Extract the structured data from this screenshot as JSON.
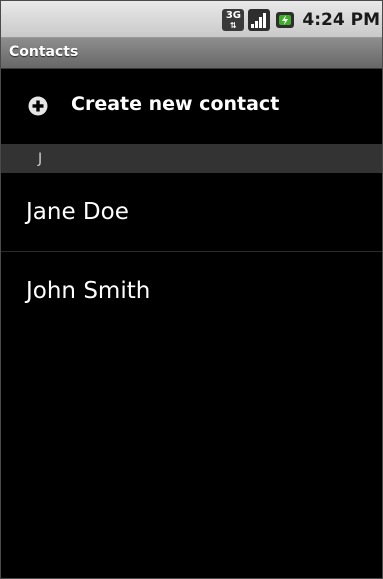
{
  "status_bar": {
    "network_label": "3G",
    "time": "4:24 PM",
    "icons": [
      "3g-data-icon",
      "signal-strength-icon",
      "battery-charging-icon"
    ],
    "colors": {
      "battery": "#3fae2a"
    }
  },
  "title_bar": {
    "title": "Contacts"
  },
  "create_contact": {
    "label": "Create new contact",
    "icon": "plus-circle-icon"
  },
  "section": {
    "letter": "J"
  },
  "contacts": [
    {
      "name": "Jane Doe"
    },
    {
      "name": "John Smith"
    }
  ]
}
